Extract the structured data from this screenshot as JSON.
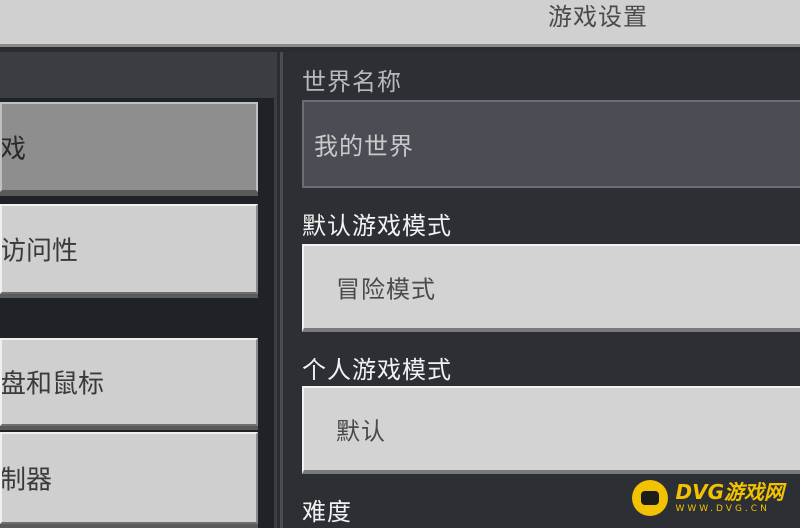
{
  "header": {
    "title": "游戏设置"
  },
  "sidebar": {
    "items": [
      {
        "label": "戏",
        "selected": true
      },
      {
        "label": "访问性",
        "selected": false
      },
      {
        "label": "盘和鼠标",
        "selected": false
      },
      {
        "label": "制器",
        "selected": false
      }
    ]
  },
  "main": {
    "world_name": {
      "label": "世界名称",
      "value": "我的世界"
    },
    "default_game_mode": {
      "label": "默认游戏模式",
      "value": "冒险模式"
    },
    "personal_game_mode": {
      "label": "个人游戏模式",
      "value": "默认"
    },
    "difficulty": {
      "label": "难度"
    }
  },
  "watermark": {
    "brand": "DVG游戏网",
    "url": "WWW.DVG.CN"
  },
  "colors": {
    "header_bg": "#d0d0d0",
    "panel_bg": "#2c2f34",
    "button_bg": "#cfcfcf",
    "selected_button_bg": "#8e8e8e",
    "text_field_bg": "#4a4d54",
    "accent": "#f2c200"
  }
}
